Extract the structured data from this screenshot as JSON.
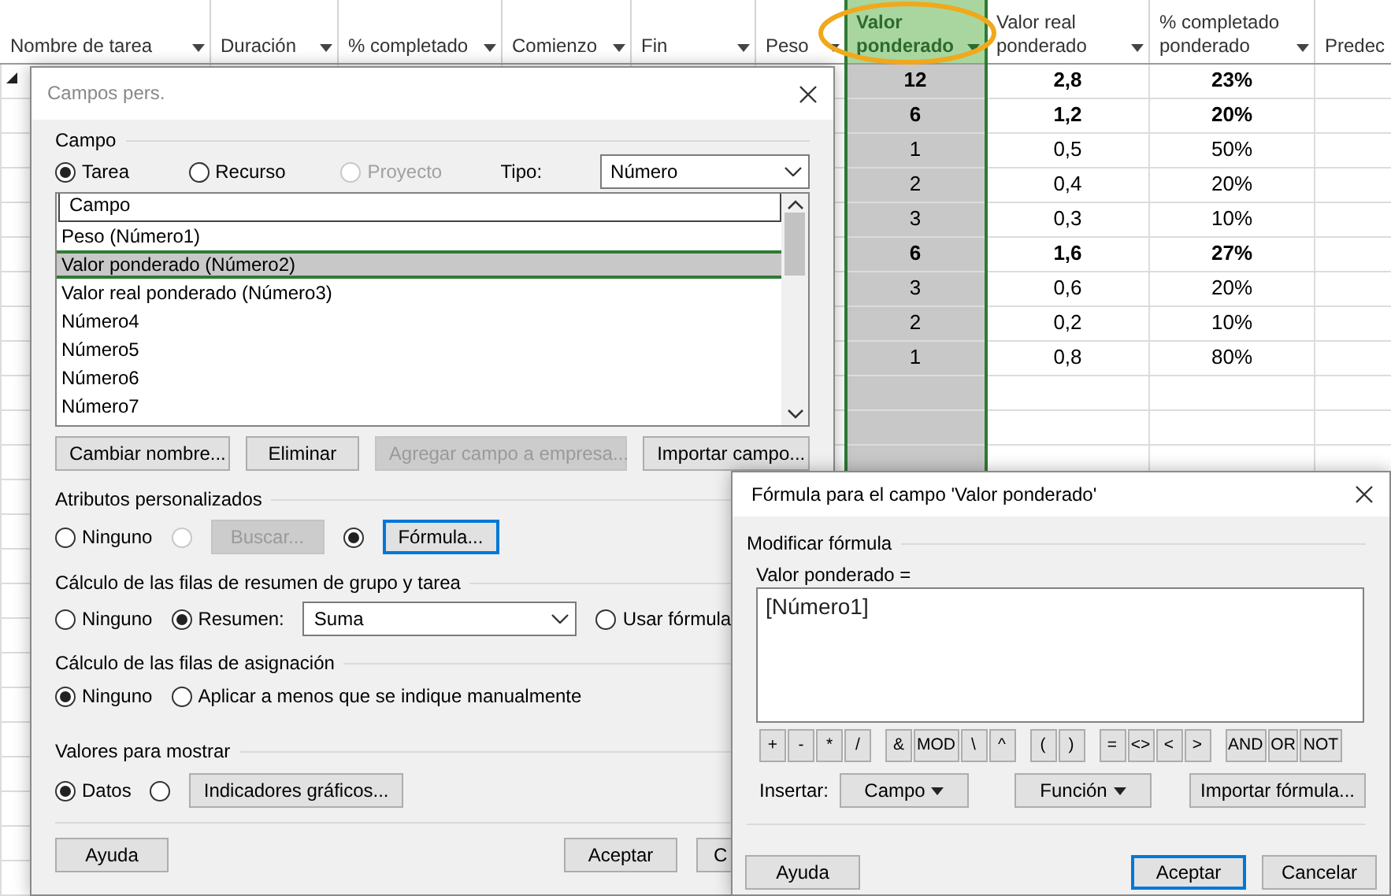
{
  "sheet": {
    "columns": [
      {
        "label": "Nombre de tarea",
        "menu": true,
        "selected": false
      },
      {
        "label": "Duración",
        "menu": true,
        "selected": false
      },
      {
        "label": "% completado",
        "menu": true,
        "selected": false
      },
      {
        "label": "Comienzo",
        "menu": true,
        "selected": false
      },
      {
        "label": "Fin",
        "menu": true,
        "selected": false
      },
      {
        "label": "Peso",
        "menu": true,
        "selected": false
      },
      {
        "label": "Valor ponderado",
        "menu": true,
        "selected": true
      },
      {
        "label": "Valor real ponderado",
        "menu": true,
        "selected": false
      },
      {
        "label": "% completado ponderado",
        "menu": true,
        "selected": false
      },
      {
        "label": "Predec",
        "menu": false,
        "selected": false
      }
    ],
    "rows": [
      {
        "summary": true,
        "expanded": true,
        "values": [
          "12",
          "2,8",
          "23%"
        ]
      },
      {
        "summary": true,
        "expanded": false,
        "values": [
          "6",
          "1,2",
          "20%"
        ]
      },
      {
        "summary": false,
        "expanded": false,
        "values": [
          "1",
          "0,5",
          "50%"
        ]
      },
      {
        "summary": false,
        "expanded": false,
        "values": [
          "2",
          "0,4",
          "20%"
        ]
      },
      {
        "summary": false,
        "expanded": false,
        "values": [
          "3",
          "0,3",
          "10%"
        ]
      },
      {
        "summary": true,
        "expanded": false,
        "values": [
          "6",
          "1,6",
          "27%"
        ]
      },
      {
        "summary": false,
        "expanded": false,
        "values": [
          "3",
          "0,6",
          "20%"
        ]
      },
      {
        "summary": false,
        "expanded": false,
        "values": [
          "2",
          "0,2",
          "10%"
        ]
      },
      {
        "summary": false,
        "expanded": false,
        "values": [
          "1",
          "0,8",
          "80%"
        ]
      }
    ]
  },
  "custom_fields_dialog": {
    "title": "Campos pers.",
    "field_section": {
      "title": "Campo",
      "controls": [
        {
          "kind": "radio",
          "label": "Tarea",
          "selected": true,
          "disabled": false
        },
        {
          "kind": "radio",
          "label": "Recurso",
          "selected": false,
          "disabled": false
        },
        {
          "kind": "radio",
          "label": "Proyecto",
          "selected": false,
          "disabled": true
        },
        {
          "kind": "label",
          "label": "Tipo:"
        },
        {
          "kind": "select",
          "value": "Número"
        }
      ],
      "list_header": "Campo",
      "fields": [
        {
          "label": "Peso (Número1)",
          "selected": false
        },
        {
          "label": "Valor ponderado (Número2)",
          "selected": true
        },
        {
          "label": "Valor real ponderado (Número3)",
          "selected": false
        },
        {
          "label": "Número4",
          "selected": false
        },
        {
          "label": "Número5",
          "selected": false
        },
        {
          "label": "Número6",
          "selected": false
        },
        {
          "label": "Número7",
          "selected": false
        }
      ],
      "buttons": [
        {
          "label": "Cambiar nombre...",
          "disabled": false,
          "focused": false
        },
        {
          "label": "Eliminar",
          "disabled": false,
          "focused": false
        },
        {
          "label": "Agregar campo a empresa...",
          "disabled": true,
          "focused": false
        },
        {
          "label": "Importar campo...",
          "disabled": false,
          "focused": false
        }
      ]
    },
    "sections": [
      {
        "title": "Atributos personalizados",
        "controls": [
          {
            "kind": "radio",
            "label": "Ninguno",
            "selected": false,
            "disabled": false
          },
          {
            "kind": "radio",
            "selected": false,
            "disabled": true
          },
          {
            "kind": "button",
            "label": "Buscar...",
            "disabled": true,
            "focused": false
          },
          {
            "kind": "radio",
            "selected": true,
            "disabled": false
          },
          {
            "kind": "button",
            "label": "Fórmula...",
            "disabled": false,
            "focused": true
          }
        ]
      },
      {
        "title": "Cálculo de las filas de resumen de grupo y tarea",
        "controls": [
          {
            "kind": "radio",
            "label": "Ninguno",
            "selected": false,
            "disabled": false
          },
          {
            "kind": "radio",
            "label": "Resumen:",
            "selected": true,
            "disabled": false
          },
          {
            "kind": "select",
            "value": "Suma"
          },
          {
            "kind": "radio",
            "label": "Usar fórmula",
            "selected": false,
            "disabled": false
          }
        ]
      },
      {
        "title": "Cálculo de las filas de asignación",
        "controls": [
          {
            "kind": "radio",
            "label": "Ninguno",
            "selected": true,
            "disabled": false
          },
          {
            "kind": "radio",
            "label": "Aplicar a menos que se indique manualmente",
            "selected": false,
            "disabled": false
          }
        ]
      },
      {
        "title": "Valores para mostrar",
        "controls": [
          {
            "kind": "radio",
            "label": "Datos",
            "selected": true,
            "disabled": false
          },
          {
            "kind": "radio",
            "selected": false,
            "disabled": false
          },
          {
            "kind": "button",
            "label": "Indicadores gráficos...",
            "disabled": false,
            "focused": false
          }
        ]
      }
    ],
    "footer_buttons": [
      {
        "label": "Ayuda",
        "disabled": false,
        "focused": false
      },
      {
        "label": "Aceptar",
        "disabled": false,
        "focused": false
      },
      {
        "label": "C",
        "disabled": false,
        "focused": false
      }
    ]
  },
  "formula_dialog": {
    "title": "Fórmula para el campo 'Valor ponderado'",
    "section_title": "Modificar fórmula",
    "formula_label": "Valor ponderado =",
    "formula": "[Número1]",
    "operator_groups": [
      [
        "+",
        "-",
        "*",
        "/"
      ],
      [
        "&",
        "MOD",
        "\\",
        "^"
      ],
      [
        "(",
        ")"
      ],
      [
        "=",
        "<>",
        "<",
        ">"
      ],
      [
        "AND",
        "OR",
        "NOT"
      ]
    ],
    "insert_label": "Insertar:",
    "insert_buttons": [
      {
        "label": "Campo",
        "dropdown": true
      },
      {
        "label": "Función",
        "dropdown": true
      },
      {
        "label": "Importar fórmula...",
        "dropdown": false
      }
    ],
    "footer_buttons": [
      {
        "label": "Ayuda",
        "disabled": false,
        "focused": false
      },
      {
        "label": "Aceptar",
        "disabled": false,
        "focused": true
      },
      {
        "label": "Cancelar",
        "disabled": false,
        "focused": false
      }
    ]
  }
}
